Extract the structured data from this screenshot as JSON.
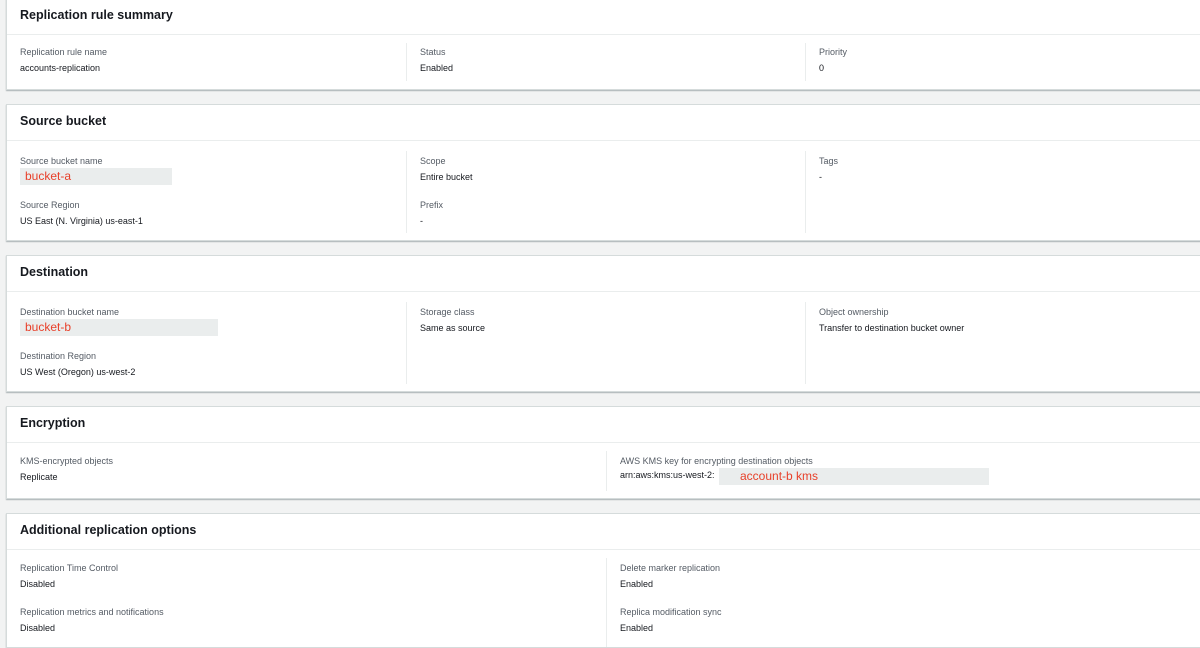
{
  "summary": {
    "title": "Replication rule summary",
    "rule_name_label": "Replication rule name",
    "rule_name_value": "accounts-replication",
    "status_label": "Status",
    "status_value": "Enabled",
    "priority_label": "Priority",
    "priority_value": "0"
  },
  "source": {
    "title": "Source bucket",
    "bucket_name_label": "Source bucket name",
    "bucket_name_value": "bucket-a",
    "region_label": "Source Region",
    "region_value": "US East (N. Virginia) us-east-1",
    "scope_label": "Scope",
    "scope_value": "Entire bucket",
    "prefix_label": "Prefix",
    "prefix_value": "-",
    "tags_label": "Tags",
    "tags_value": "-"
  },
  "destination": {
    "title": "Destination",
    "bucket_name_label": "Destination bucket name",
    "bucket_name_value": "bucket-b",
    "region_label": "Destination Region",
    "region_value": "US West (Oregon) us-west-2",
    "storage_class_label": "Storage class",
    "storage_class_value": "Same as source",
    "ownership_label": "Object ownership",
    "ownership_value": "Transfer to destination bucket owner"
  },
  "encryption": {
    "title": "Encryption",
    "kms_objects_label": "KMS-encrypted objects",
    "kms_objects_value": "Replicate",
    "kms_key_label": "AWS KMS key for encrypting destination objects",
    "kms_key_prefix": "arn:aws:kms:us-west-2:",
    "kms_key_redacted": "account-b kms"
  },
  "additional": {
    "title": "Additional replication options",
    "rtc_label": "Replication Time Control",
    "rtc_value": "Disabled",
    "metrics_label": "Replication metrics and notifications",
    "metrics_value": "Disabled",
    "delete_marker_label": "Delete marker replication",
    "delete_marker_value": "Enabled",
    "replica_sync_label": "Replica modification sync",
    "replica_sync_value": "Enabled"
  },
  "colors": {
    "page_bg": "#f2f3f3",
    "panel_border": "#d5dbdb",
    "label": "#545b64",
    "annotation": "#e8402a",
    "redaction": "#eaeded"
  }
}
